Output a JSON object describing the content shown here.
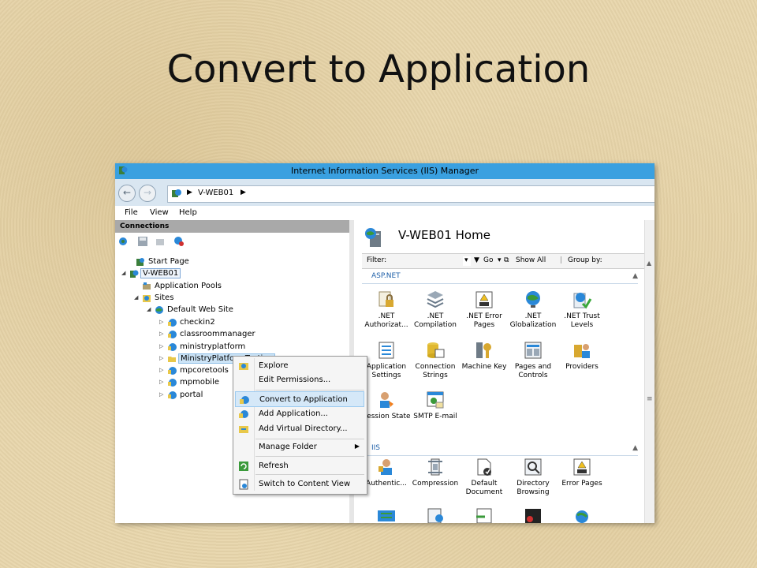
{
  "slide": {
    "title": "Convert to Application"
  },
  "window": {
    "title": "Internet Information Services (IIS) Manager"
  },
  "address": {
    "crumb": "V-WEB01"
  },
  "menubar": {
    "file": "File",
    "view": "View",
    "help": "Help"
  },
  "connections": {
    "header": "Connections",
    "tree": [
      {
        "label": "Start Page",
        "icon": "start-page-icon"
      },
      {
        "label": "V-WEB01",
        "icon": "server-icon"
      },
      {
        "label": "Application Pools",
        "icon": "app-pools-icon"
      },
      {
        "label": "Sites",
        "icon": "sites-icon"
      },
      {
        "label": "Default Web Site",
        "icon": "globe-icon"
      },
      {
        "label": "checkin2",
        "icon": "app-icon"
      },
      {
        "label": "classroommanager",
        "icon": "app-icon"
      },
      {
        "label": "ministryplatform",
        "icon": "app-icon"
      },
      {
        "label": "MinistryPlatformTesting",
        "icon": "folder-icon"
      },
      {
        "label": "mpcoretools",
        "icon": "app-icon"
      },
      {
        "label": "mpmobile",
        "icon": "app-icon"
      },
      {
        "label": "portal",
        "icon": "app-icon"
      }
    ]
  },
  "main": {
    "title": "V-WEB01 Home",
    "filter_label": "Filter:",
    "go_label": "Go",
    "show_all_label": "Show All",
    "group_by_label": "Group by:",
    "groups": [
      {
        "name": "ASP.NET"
      },
      {
        "name": "IIS"
      }
    ],
    "features": [
      {
        "label": ".NET Authorizat...",
        "icon": "lock-icon"
      },
      {
        "label": ".NET Compilation",
        "icon": "compile-icon"
      },
      {
        "label": ".NET Error Pages",
        "icon": "error-page-icon"
      },
      {
        "label": ".NET Globalization",
        "icon": "globe-icon"
      },
      {
        "label": ".NET Trust Levels",
        "icon": "trust-icon"
      },
      {
        "label": "Application Settings",
        "icon": "settings-list-icon"
      },
      {
        "label": "Connection Strings",
        "icon": "database-icon"
      },
      {
        "label": "Machine Key",
        "icon": "key-icon"
      },
      {
        "label": "Pages and Controls",
        "icon": "pages-icon"
      },
      {
        "label": "Providers",
        "icon": "providers-icon"
      },
      {
        "label": "Session State",
        "icon": "user-icon"
      },
      {
        "label": "SMTP E-mail",
        "icon": "email-icon"
      },
      {
        "label": "Authentic...",
        "icon": "auth-user-icon"
      },
      {
        "label": "Compression",
        "icon": "compression-icon"
      },
      {
        "label": "Default Document",
        "icon": "document-icon"
      },
      {
        "label": "Directory Browsing",
        "icon": "directory-icon"
      },
      {
        "label": "Error Pages",
        "icon": "error-page-icon"
      }
    ]
  },
  "context_menu": {
    "items": [
      {
        "label": "Explore",
        "icon": "explore-icon"
      },
      {
        "label": "Edit Permissions...",
        "icon": ""
      },
      {
        "label": "Convert to Application",
        "icon": "convert-icon"
      },
      {
        "label": "Add Application...",
        "icon": "add-app-icon"
      },
      {
        "label": "Add Virtual Directory...",
        "icon": "add-vdir-icon"
      },
      {
        "label": "Manage Folder",
        "icon": ""
      },
      {
        "label": "Refresh",
        "icon": "refresh-icon"
      },
      {
        "label": "Switch to Content View",
        "icon": "content-view-icon"
      }
    ]
  },
  "colors": {
    "titlebar": "#3aa0e0",
    "menu_hover": "#d5e8f8",
    "group_header": "#1e5fa8",
    "slide_bg": "#e8d6ab"
  }
}
